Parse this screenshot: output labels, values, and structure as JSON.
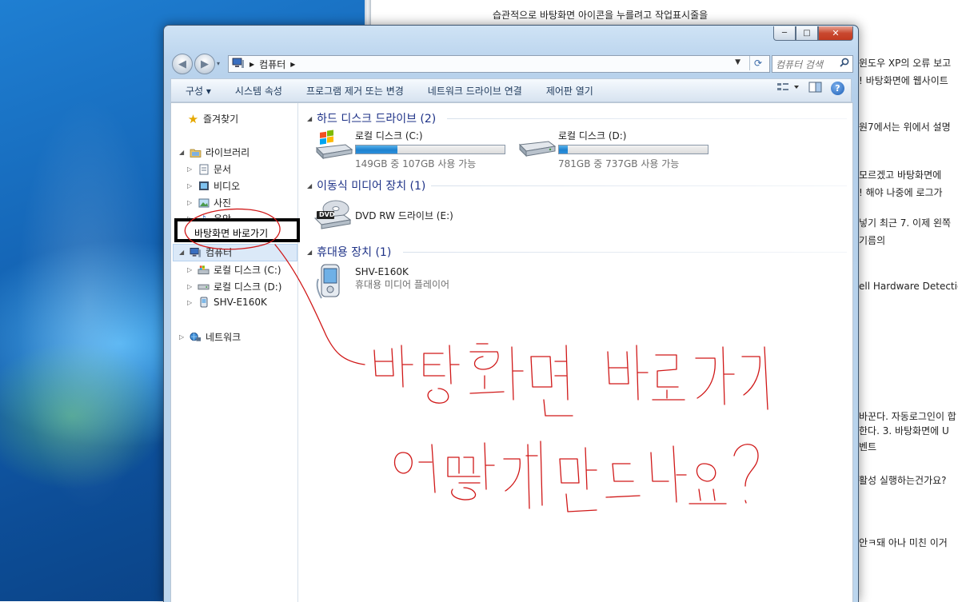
{
  "background_page": {
    "lines": [
      "습관적으로 바탕화면 아이콘을 누를려고 작업표시줄을",
      "윈도우 XP의 오류 보고",
      "! 바탕화면에 웹사이트",
      "원7에서는 위에서 설명",
      "모르겠고 바탕화면에",
      "! 해야 나중에 로그가",
      "넣기 최근 7. 이제 왼쪽",
      "기름의",
      "ell Hardware Detection",
      "바꾼다. 자동로그인이 합",
      "한다. 3. 바탕화면에 U",
      "벤트",
      "활성 실행하는건가요?",
      "안ㅋ돼 아나 미친 이거"
    ]
  },
  "window": {
    "caption": {
      "minimize": "─",
      "maximize": "□",
      "close": "✕"
    },
    "nav": {
      "back_icon": "back-arrow-icon",
      "forward_icon": "forward-arrow-icon",
      "breadcrumb": [
        "컴퓨터"
      ],
      "search_placeholder": "컴퓨터 검색"
    },
    "toolbar": {
      "organize": "구성 ▾",
      "items": [
        "시스템 속성",
        "프로그램 제거 또는 변경",
        "네트워크 드라이브 연결",
        "제어판 열기"
      ]
    },
    "navpane": {
      "favorites": "즐겨찾기",
      "libraries": "라이브러리",
      "library_items": [
        "문서",
        "비디오",
        "사진",
        "음악"
      ],
      "computer": "컴퓨터",
      "computer_items": [
        "로컬 디스크 (C:)",
        "로컬 디스크 (D:)",
        "SHV-E160K"
      ],
      "network": "네트워크"
    },
    "content": {
      "groups": [
        {
          "title": "하드 디스크 드라이브 (2)"
        },
        {
          "title": "이동식 미디어 장치 (1)"
        },
        {
          "title": "휴대용 장치 (1)"
        }
      ],
      "drives": [
        {
          "name": "로컬 디스크 (C:)",
          "free": "149GB 중 107GB 사용 가능",
          "used_fraction": 0.28
        },
        {
          "name": "로컬 디스크 (D:)",
          "free": "781GB 중 737GB 사용 가능",
          "used_fraction": 0.06
        }
      ],
      "removable": {
        "name": "DVD RW 드라이브 (E:)",
        "icon_text": "DVD"
      },
      "portable": {
        "name": "SHV-E160K",
        "type": "휴대용 미디어 플레이어"
      }
    }
  },
  "annotation": {
    "box_label": "바탕화면 바로가기",
    "handwriting_line1": "바탕화면바로가기",
    "handwriting_line2": "어떻게만드나요?",
    "ink_color": "#d01818"
  }
}
